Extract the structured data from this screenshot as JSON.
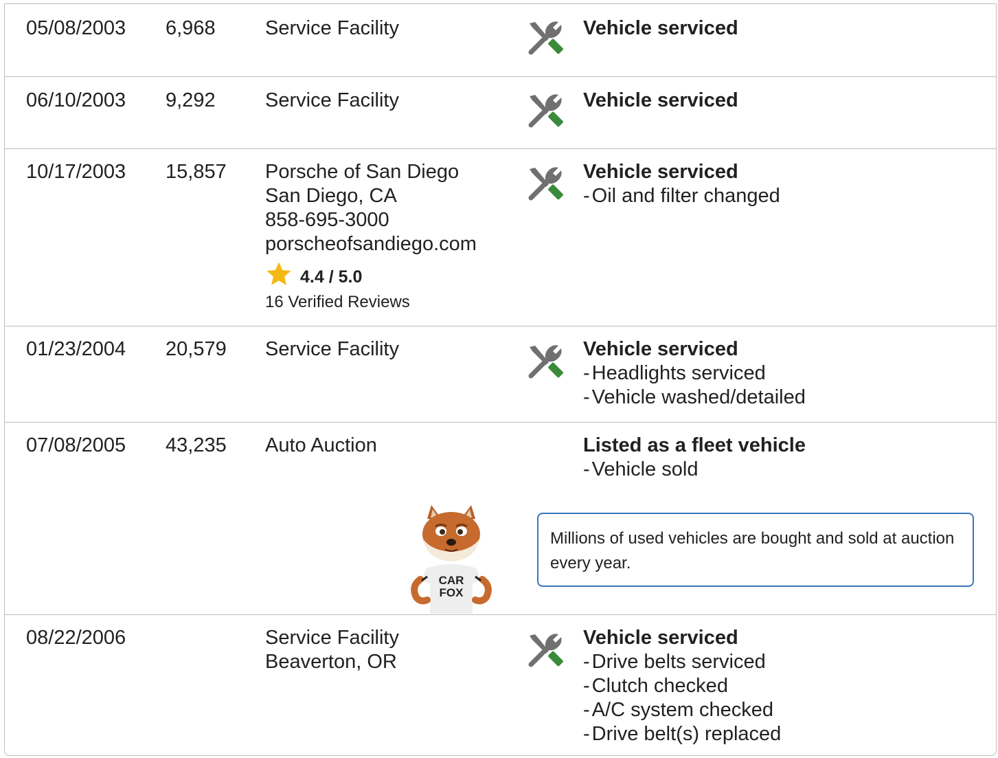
{
  "colors": {
    "border": "#bdbdbd",
    "icon_gray": "#707070",
    "icon_green": "#3a8a3a",
    "star": "#f5b915",
    "callout_border": "#3777bc"
  },
  "records": [
    {
      "date": "05/08/2003",
      "odometer": "6,968",
      "source": [
        "Service Facility"
      ],
      "icon": "wrench-screwdriver-icon",
      "title": "Vehicle serviced",
      "details": []
    },
    {
      "date": "06/10/2003",
      "odometer": "9,292",
      "source": [
        "Service Facility"
      ],
      "icon": "wrench-screwdriver-icon",
      "title": "Vehicle serviced",
      "details": []
    },
    {
      "date": "10/17/2003",
      "odometer": "15,857",
      "source": [
        "Porsche of San Diego",
        "San Diego, CA",
        "858-695-3000",
        "porscheofsandiego.com"
      ],
      "rating": {
        "value": "4.4 / 5.0",
        "score": 4.4,
        "reviews": "16 Verified Reviews",
        "icon": "star-icon"
      },
      "icon": "wrench-screwdriver-icon",
      "title": "Vehicle serviced",
      "details": [
        "Oil and filter changed"
      ]
    },
    {
      "date": "01/23/2004",
      "odometer": "20,579",
      "source": [
        "Service Facility"
      ],
      "icon": "wrench-screwdriver-icon",
      "title": "Vehicle serviced",
      "details": [
        "Headlights serviced",
        "Vehicle washed/detailed"
      ]
    },
    {
      "date": "07/08/2005",
      "odometer": "43,235",
      "source": [
        "Auto Auction"
      ],
      "icon": "",
      "title": "Listed as a fleet vehicle",
      "details": [
        "Vehicle sold"
      ],
      "callout": {
        "text": "Millions of used vehicles are bought and sold at auction every year.",
        "mascot_shirt": [
          "CAR",
          "FOX"
        ]
      }
    },
    {
      "date": "08/22/2006",
      "odometer": "",
      "source": [
        "Service Facility",
        "Beaverton, OR"
      ],
      "icon": "wrench-screwdriver-icon",
      "title": "Vehicle serviced",
      "details": [
        "Drive belts serviced",
        "Clutch checked",
        "A/C system checked",
        "Drive belt(s) replaced"
      ]
    }
  ]
}
